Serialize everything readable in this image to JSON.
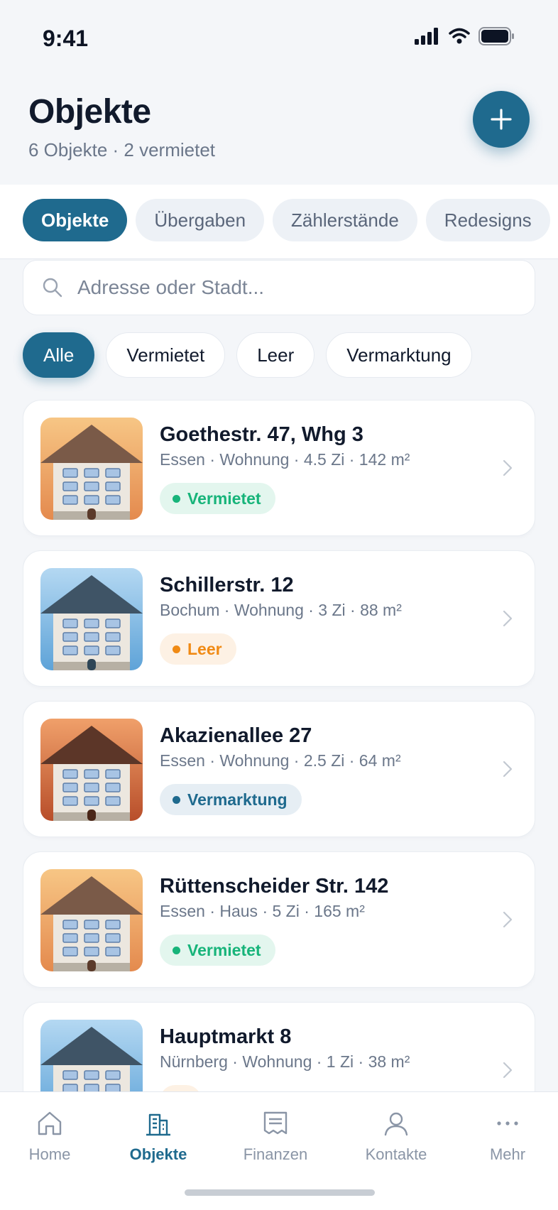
{
  "status": {
    "time": "9:41"
  },
  "header": {
    "title": "Objekte",
    "subtitle": "6 Objekte · 2 vermietet"
  },
  "tabs": [
    {
      "label": "Objekte",
      "active": true
    },
    {
      "label": "Übergaben",
      "active": false
    },
    {
      "label": "Zählerstände",
      "active": false
    },
    {
      "label": "Redesigns",
      "active": false
    }
  ],
  "search": {
    "placeholder": "Adresse oder Stadt..."
  },
  "filters": [
    {
      "label": "Alle",
      "active": true
    },
    {
      "label": "Vermietet",
      "active": false
    },
    {
      "label": "Leer",
      "active": false
    },
    {
      "label": "Vermarktung",
      "active": false
    }
  ],
  "properties": [
    {
      "title": "Goethestr. 47, Whg 3",
      "meta": "Essen · Wohnung · 4.5 Zi · 142 m²",
      "status": "Vermietet",
      "status_color": "green",
      "theme": "warm"
    },
    {
      "title": "Schillerstr. 12",
      "meta": "Bochum · Wohnung · 3 Zi · 88 m²",
      "status": "Leer",
      "status_color": "orange",
      "theme": "blue"
    },
    {
      "title": "Akazienallee 27",
      "meta": "Essen · Wohnung · 2.5 Zi · 64 m²",
      "status": "Vermarktung",
      "status_color": "blue",
      "theme": "red"
    },
    {
      "title": "Rüttenscheider Str. 142",
      "meta": "Essen · Haus · 5 Zi · 165 m²",
      "status": "Vermietet",
      "status_color": "green",
      "theme": "warm"
    },
    {
      "title": "Hauptmarkt 8",
      "meta": "Nürnberg · Wohnung · 1 Zi · 38 m²",
      "status": "",
      "status_color": "orange",
      "theme": "blue"
    }
  ],
  "nav": [
    {
      "label": "Home",
      "icon": "home-icon",
      "active": false
    },
    {
      "label": "Objekte",
      "icon": "building-icon",
      "active": true
    },
    {
      "label": "Finanzen",
      "icon": "receipt-icon",
      "active": false
    },
    {
      "label": "Kontakte",
      "icon": "person-icon",
      "active": false
    },
    {
      "label": "Mehr",
      "icon": "more-icon",
      "active": false
    }
  ],
  "colors": {
    "primary": "#1f6a8e",
    "green": "#17b47a",
    "orange": "#f08a14"
  }
}
